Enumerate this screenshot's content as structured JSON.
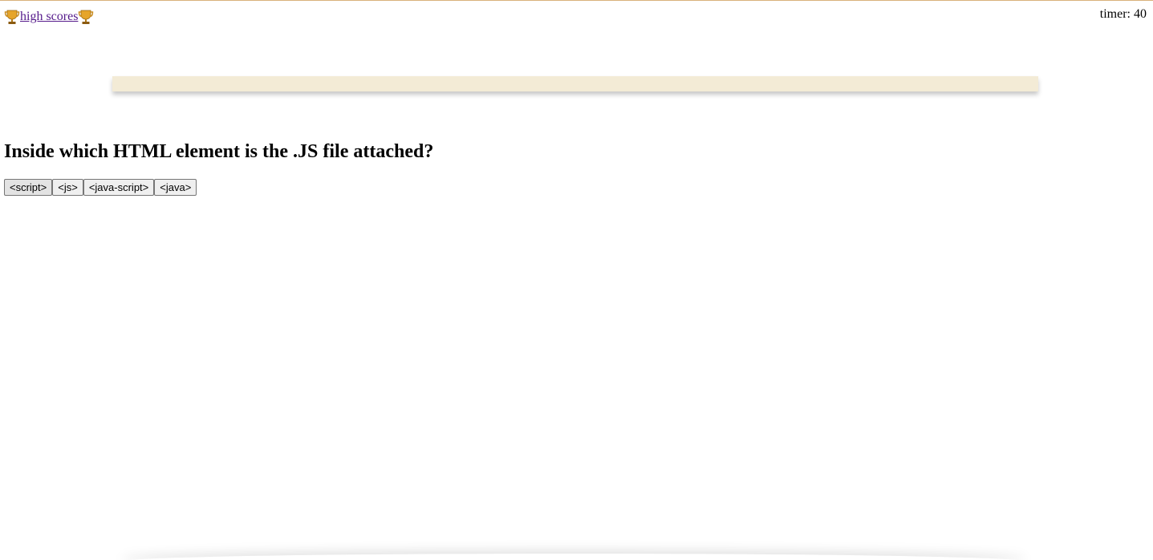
{
  "header": {
    "high_scores_label": "high scores",
    "trophy_icon": "trophy-icon",
    "timer_label": "timer:",
    "timer_value": "40"
  },
  "quiz": {
    "progress": 0,
    "question": "Inside which HTML element is the .JS file attached?",
    "answers": [
      {
        "label": "<script>"
      },
      {
        "label": "<js>"
      },
      {
        "label": "<java-script>"
      },
      {
        "label": "<java>"
      }
    ]
  },
  "colors": {
    "progress_bar_bg": "#f3ebd6",
    "link": "#551a8b",
    "top_border": "#d9b27c"
  }
}
